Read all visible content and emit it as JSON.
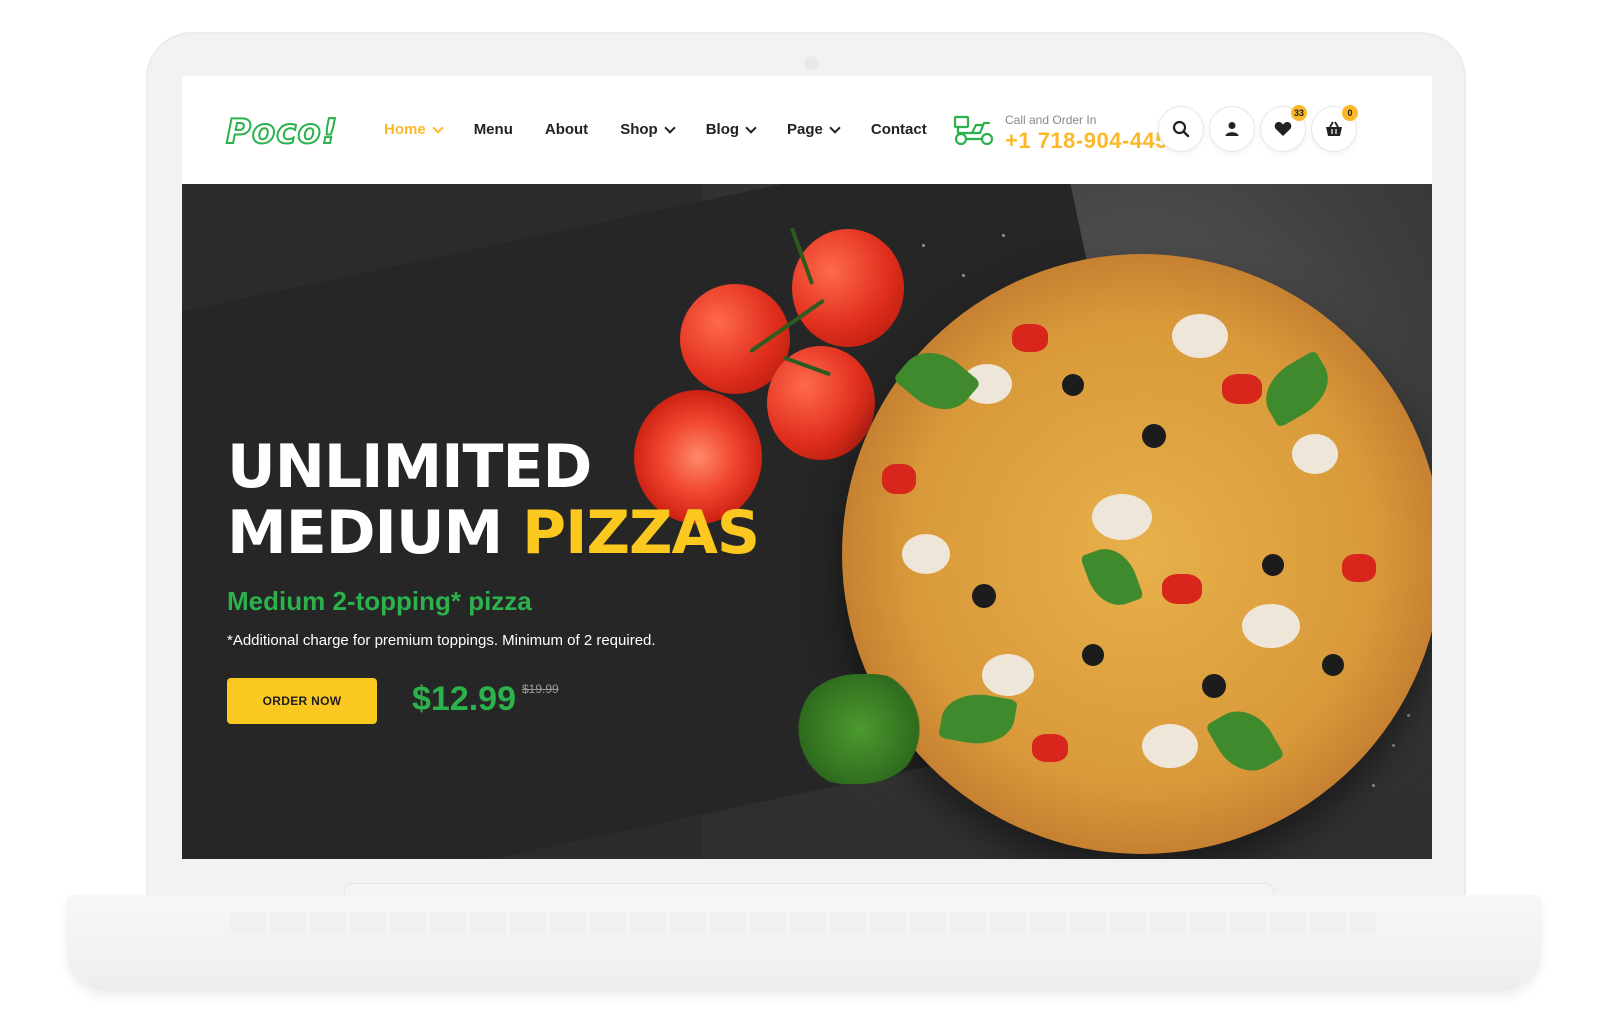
{
  "brand": {
    "logo_text": "Poco!"
  },
  "nav": {
    "items": [
      {
        "label": "Home",
        "dropdown": true,
        "active": true
      },
      {
        "label": "Menu",
        "dropdown": false
      },
      {
        "label": "About",
        "dropdown": false
      },
      {
        "label": "Shop",
        "dropdown": true
      },
      {
        "label": "Blog",
        "dropdown": true
      },
      {
        "label": "Page",
        "dropdown": true
      },
      {
        "label": "Contact",
        "dropdown": false
      }
    ]
  },
  "contact": {
    "label": "Call and Order In",
    "phone": "+1 718-904-4450",
    "icon": "delivery-scooter-icon"
  },
  "header_icons": {
    "search": {
      "icon": "search-icon"
    },
    "account": {
      "icon": "user-icon"
    },
    "wishlist": {
      "icon": "heart-icon",
      "count": "33"
    },
    "cart": {
      "icon": "basket-icon",
      "count": "0"
    }
  },
  "hero": {
    "headline_line1": "UNLIMITED",
    "headline_line2_white": "MEDIUM",
    "headline_line2_accent": "PIZZAS",
    "subheadline": "Medium 2-topping* pizza",
    "note": "*Additional charge for premium toppings. Minimum of 2 required.",
    "cta_label": "ORDER NOW",
    "price": "$12.99",
    "old_price": "$19.99"
  },
  "colors": {
    "brand_green": "#2bb24c",
    "accent_yellow": "#fbc81f",
    "nav_active": "#fbb829",
    "hero_bg": "#2b2b2b"
  }
}
